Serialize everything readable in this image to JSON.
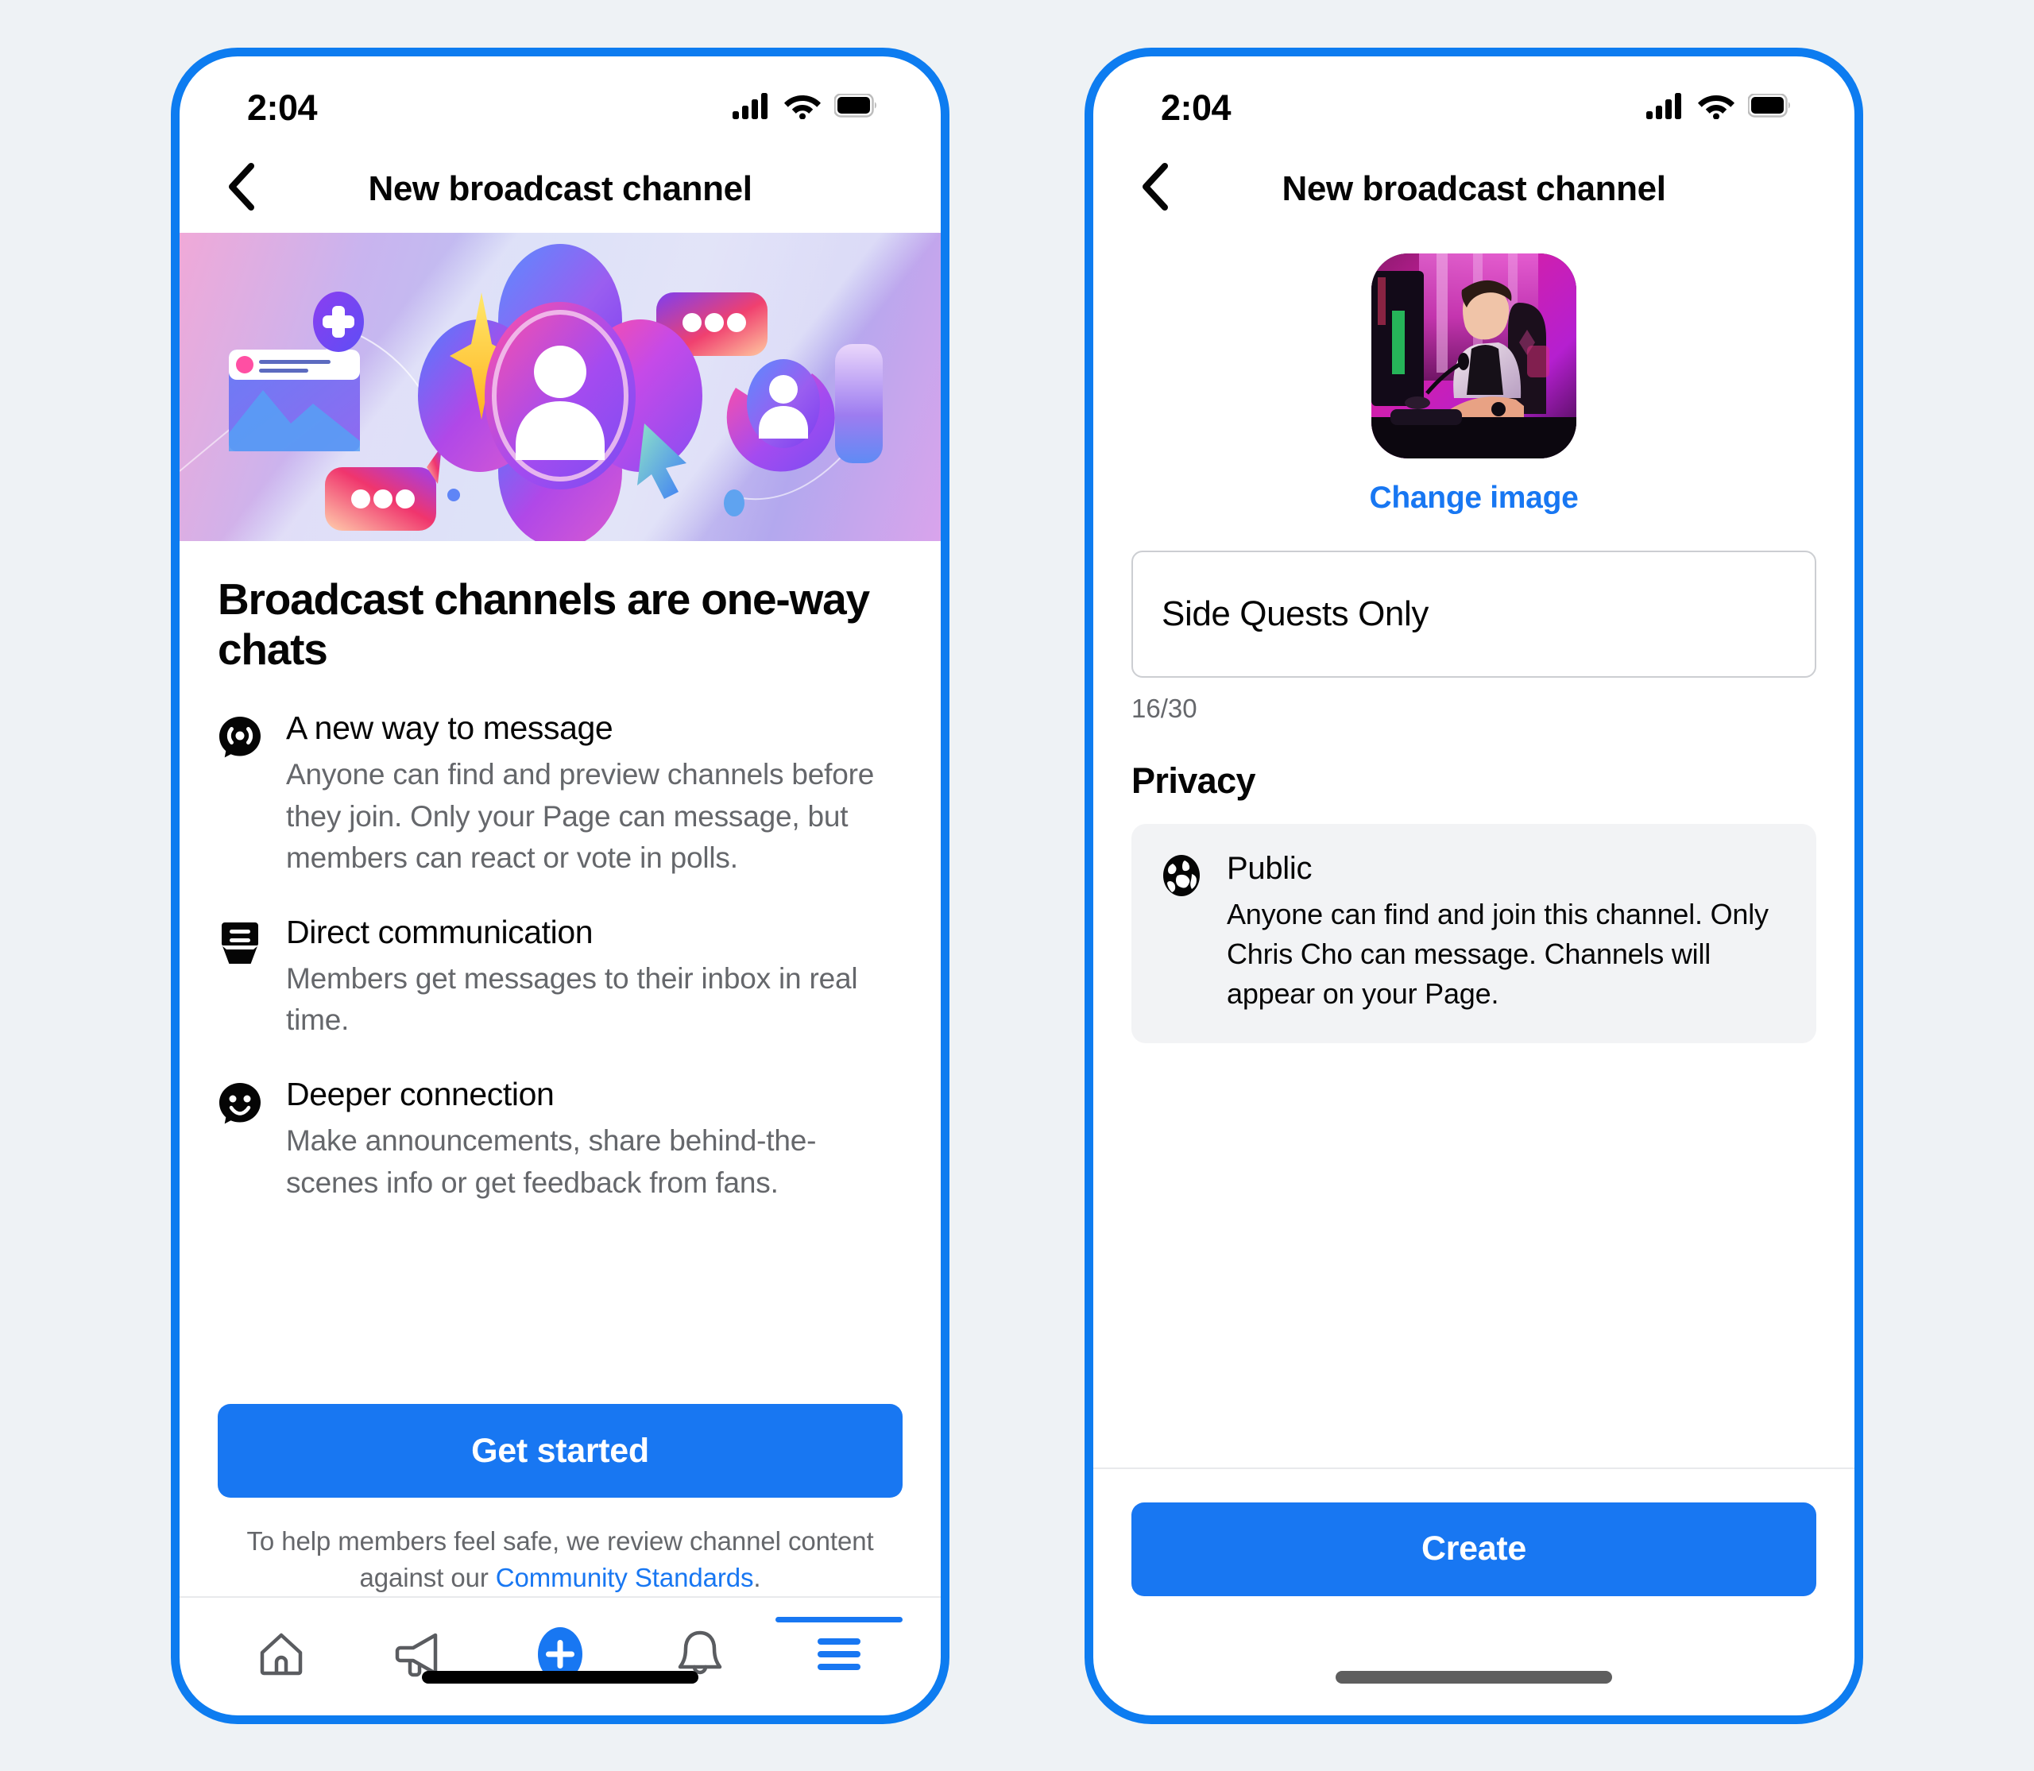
{
  "phone1": {
    "status": {
      "time": "2:04",
      "signal_icon": "cellular-signal-icon",
      "wifi_icon": "wifi-icon",
      "battery_icon": "battery-full-icon"
    },
    "nav": {
      "back_icon": "chevron-left-icon",
      "title": "New broadcast channel"
    },
    "hero": {
      "alt": "broadcast-channels-illustration"
    },
    "headline": "Broadcast channels are one-way chats",
    "features": [
      {
        "icon": "broadcast-bubble-icon",
        "title": "A new way to message",
        "desc": "Anyone can find and preview channels before they join. Only your Page can message, but members can react or vote in polls."
      },
      {
        "icon": "inbox-tray-icon",
        "title": "Direct communication",
        "desc": "Members get messages to their inbox in real time."
      },
      {
        "icon": "smiley-bubble-icon",
        "title": "Deeper connection",
        "desc": "Make announcements, share behind-the-scenes info or get feedback from fans."
      }
    ],
    "cta": {
      "label": "Get started"
    },
    "legal": {
      "text_before": "To help members feel safe, we review channel content against our ",
      "link": "Community Standards",
      "text_after": "."
    },
    "tabs": [
      {
        "name": "home",
        "icon": "home-icon",
        "active": false
      },
      {
        "name": "pages",
        "icon": "megaphone-icon",
        "active": false
      },
      {
        "name": "create",
        "icon": "plus-circle-icon",
        "active": false
      },
      {
        "name": "notifications",
        "icon": "bell-icon",
        "active": false
      },
      {
        "name": "menu",
        "icon": "hamburger-menu-icon",
        "active": true
      }
    ]
  },
  "phone2": {
    "status": {
      "time": "2:04",
      "signal_icon": "cellular-signal-icon",
      "wifi_icon": "wifi-icon",
      "battery_icon": "battery-full-icon"
    },
    "nav": {
      "back_icon": "chevron-left-icon",
      "title": "New broadcast channel"
    },
    "avatar": {
      "icon": "channel-avatar-photo",
      "change_label": "Change image"
    },
    "name_input": {
      "value": "Side Quests Only",
      "placeholder": "Channel name",
      "counter": "16/30"
    },
    "privacy": {
      "section_title": "Privacy",
      "option_icon": "globe-icon",
      "option_label": "Public",
      "option_desc": "Anyone can find and join this channel. Only Chris Cho can message. Channels will appear on your Page."
    },
    "cta": {
      "label": "Create"
    }
  },
  "colors": {
    "page_background": "#eef2f5",
    "phone_border": "#0d7cf0",
    "accent_blue": "#1877f2",
    "text_primary": "#050505",
    "text_secondary": "#65676b",
    "card_grey": "#f2f3f5"
  }
}
